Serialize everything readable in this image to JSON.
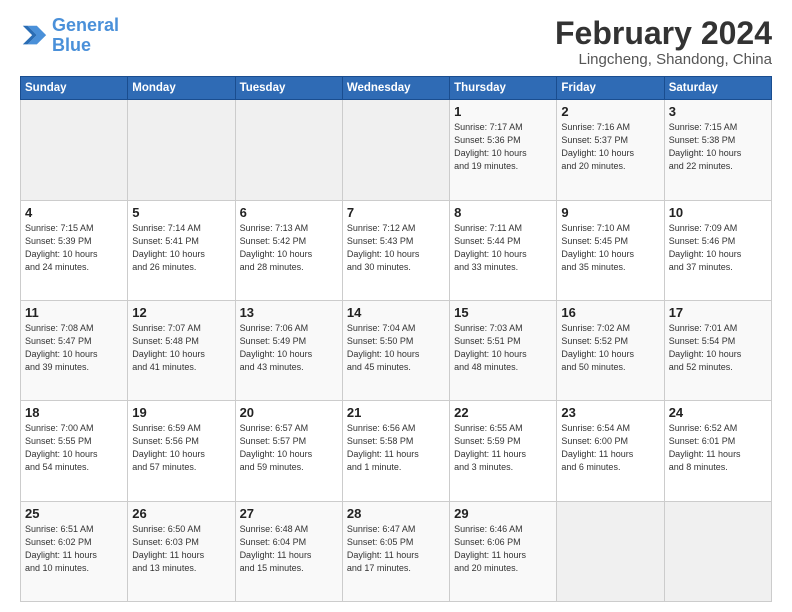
{
  "header": {
    "logo_line1": "General",
    "logo_line2": "Blue",
    "title": "February 2024",
    "subtitle": "Lingcheng, Shandong, China"
  },
  "weekdays": [
    "Sunday",
    "Monday",
    "Tuesday",
    "Wednesday",
    "Thursday",
    "Friday",
    "Saturday"
  ],
  "weeks": [
    [
      {
        "num": "",
        "info": ""
      },
      {
        "num": "",
        "info": ""
      },
      {
        "num": "",
        "info": ""
      },
      {
        "num": "",
        "info": ""
      },
      {
        "num": "1",
        "info": "Sunrise: 7:17 AM\nSunset: 5:36 PM\nDaylight: 10 hours\nand 19 minutes."
      },
      {
        "num": "2",
        "info": "Sunrise: 7:16 AM\nSunset: 5:37 PM\nDaylight: 10 hours\nand 20 minutes."
      },
      {
        "num": "3",
        "info": "Sunrise: 7:15 AM\nSunset: 5:38 PM\nDaylight: 10 hours\nand 22 minutes."
      }
    ],
    [
      {
        "num": "4",
        "info": "Sunrise: 7:15 AM\nSunset: 5:39 PM\nDaylight: 10 hours\nand 24 minutes."
      },
      {
        "num": "5",
        "info": "Sunrise: 7:14 AM\nSunset: 5:41 PM\nDaylight: 10 hours\nand 26 minutes."
      },
      {
        "num": "6",
        "info": "Sunrise: 7:13 AM\nSunset: 5:42 PM\nDaylight: 10 hours\nand 28 minutes."
      },
      {
        "num": "7",
        "info": "Sunrise: 7:12 AM\nSunset: 5:43 PM\nDaylight: 10 hours\nand 30 minutes."
      },
      {
        "num": "8",
        "info": "Sunrise: 7:11 AM\nSunset: 5:44 PM\nDaylight: 10 hours\nand 33 minutes."
      },
      {
        "num": "9",
        "info": "Sunrise: 7:10 AM\nSunset: 5:45 PM\nDaylight: 10 hours\nand 35 minutes."
      },
      {
        "num": "10",
        "info": "Sunrise: 7:09 AM\nSunset: 5:46 PM\nDaylight: 10 hours\nand 37 minutes."
      }
    ],
    [
      {
        "num": "11",
        "info": "Sunrise: 7:08 AM\nSunset: 5:47 PM\nDaylight: 10 hours\nand 39 minutes."
      },
      {
        "num": "12",
        "info": "Sunrise: 7:07 AM\nSunset: 5:48 PM\nDaylight: 10 hours\nand 41 minutes."
      },
      {
        "num": "13",
        "info": "Sunrise: 7:06 AM\nSunset: 5:49 PM\nDaylight: 10 hours\nand 43 minutes."
      },
      {
        "num": "14",
        "info": "Sunrise: 7:04 AM\nSunset: 5:50 PM\nDaylight: 10 hours\nand 45 minutes."
      },
      {
        "num": "15",
        "info": "Sunrise: 7:03 AM\nSunset: 5:51 PM\nDaylight: 10 hours\nand 48 minutes."
      },
      {
        "num": "16",
        "info": "Sunrise: 7:02 AM\nSunset: 5:52 PM\nDaylight: 10 hours\nand 50 minutes."
      },
      {
        "num": "17",
        "info": "Sunrise: 7:01 AM\nSunset: 5:54 PM\nDaylight: 10 hours\nand 52 minutes."
      }
    ],
    [
      {
        "num": "18",
        "info": "Sunrise: 7:00 AM\nSunset: 5:55 PM\nDaylight: 10 hours\nand 54 minutes."
      },
      {
        "num": "19",
        "info": "Sunrise: 6:59 AM\nSunset: 5:56 PM\nDaylight: 10 hours\nand 57 minutes."
      },
      {
        "num": "20",
        "info": "Sunrise: 6:57 AM\nSunset: 5:57 PM\nDaylight: 10 hours\nand 59 minutes."
      },
      {
        "num": "21",
        "info": "Sunrise: 6:56 AM\nSunset: 5:58 PM\nDaylight: 11 hours\nand 1 minute."
      },
      {
        "num": "22",
        "info": "Sunrise: 6:55 AM\nSunset: 5:59 PM\nDaylight: 11 hours\nand 3 minutes."
      },
      {
        "num": "23",
        "info": "Sunrise: 6:54 AM\nSunset: 6:00 PM\nDaylight: 11 hours\nand 6 minutes."
      },
      {
        "num": "24",
        "info": "Sunrise: 6:52 AM\nSunset: 6:01 PM\nDaylight: 11 hours\nand 8 minutes."
      }
    ],
    [
      {
        "num": "25",
        "info": "Sunrise: 6:51 AM\nSunset: 6:02 PM\nDaylight: 11 hours\nand 10 minutes."
      },
      {
        "num": "26",
        "info": "Sunrise: 6:50 AM\nSunset: 6:03 PM\nDaylight: 11 hours\nand 13 minutes."
      },
      {
        "num": "27",
        "info": "Sunrise: 6:48 AM\nSunset: 6:04 PM\nDaylight: 11 hours\nand 15 minutes."
      },
      {
        "num": "28",
        "info": "Sunrise: 6:47 AM\nSunset: 6:05 PM\nDaylight: 11 hours\nand 17 minutes."
      },
      {
        "num": "29",
        "info": "Sunrise: 6:46 AM\nSunset: 6:06 PM\nDaylight: 11 hours\nand 20 minutes."
      },
      {
        "num": "",
        "info": ""
      },
      {
        "num": "",
        "info": ""
      }
    ]
  ]
}
